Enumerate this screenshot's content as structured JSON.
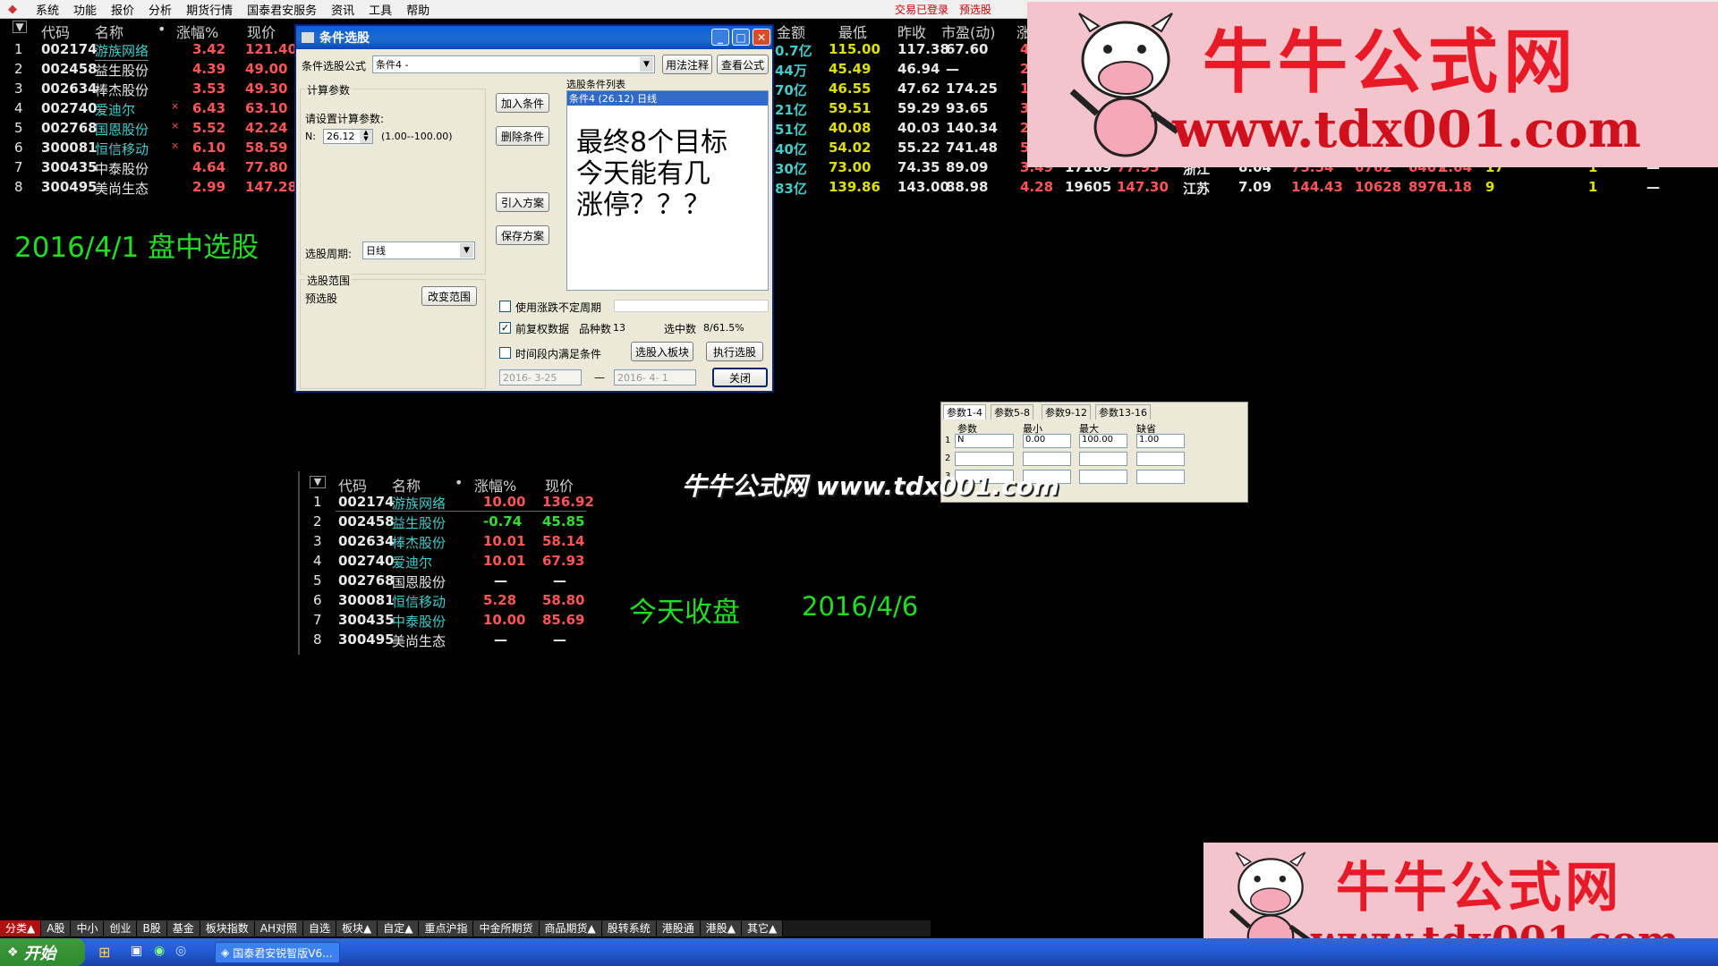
{
  "menu": {
    "items": [
      "系统",
      "功能",
      "报价",
      "分析",
      "期货行情",
      "国泰君安服务",
      "资讯",
      "工具",
      "帮助"
    ],
    "right1": "交易已登录",
    "right2": "预选股"
  },
  "top_table": {
    "headers": [
      "代码",
      "名称",
      "•",
      "涨幅%",
      "现价",
      "金额",
      "最低",
      "昨收",
      "市盈(动)",
      "涨"
    ],
    "rows": [
      {
        "n": "1",
        "code": "002174",
        "name": "游族网络",
        "mark": "",
        "chg": "3.42",
        "price": "121.40",
        "amt": "0.7亿",
        "low": "115.00",
        "prev": "117.38",
        "pe": "67.60",
        "rest": [
          "4"
        ]
      },
      {
        "n": "2",
        "code": "002458",
        "name": "益生股份",
        "mark": "",
        "chg": "4.39",
        "price": "49.00",
        "amt": "44万",
        "low": "45.49",
        "prev": "46.94",
        "pe": "—",
        "rest": [
          "2"
        ]
      },
      {
        "n": "3",
        "code": "002634",
        "name": "棒杰股份",
        "mark": "",
        "chg": "3.53",
        "price": "49.30",
        "amt": "70亿",
        "low": "46.55",
        "prev": "47.62",
        "pe": "174.25",
        "rest": [
          "1"
        ]
      },
      {
        "n": "4",
        "code": "002740",
        "name": "爱迪尔",
        "mark": "×",
        "chg": "6.43",
        "price": "63.10",
        "amt": "21亿",
        "low": "59.51",
        "prev": "59.29",
        "pe": "93.65",
        "rest": [
          "3"
        ]
      },
      {
        "n": "5",
        "code": "002768",
        "name": "国恩股份",
        "mark": "×",
        "chg": "5.52",
        "price": "42.24",
        "amt": "51亿",
        "low": "40.08",
        "prev": "40.03",
        "pe": "140.34",
        "rest": [
          "2"
        ]
      },
      {
        "n": "6",
        "code": "300081",
        "name": "恒信移动",
        "mark": "×",
        "chg": "6.10",
        "price": "58.59",
        "amt": "40亿",
        "low": "54.02",
        "prev": "55.22",
        "pe": "741.48",
        "rest": [
          "5"
        ]
      },
      {
        "n": "7",
        "code": "300435",
        "name": "中泰股份",
        "mark": "",
        "chg": "4.64",
        "price": "77.80",
        "amt": "30亿",
        "low": "73.00",
        "prev": "74.35",
        "pe": "89.09",
        "rest": [
          "3.49",
          "17169",
          "77.95",
          "浙江",
          "8.04",
          "75.54",
          "6762",
          "6407",
          "1.04",
          "17",
          "1",
          "—"
        ]
      },
      {
        "n": "8",
        "code": "300495",
        "name": "美尚生态",
        "mark": "",
        "chg": "2.99",
        "price": "147.28",
        "amt": "83亿",
        "low": "139.86",
        "prev": "143.00",
        "pe": "88.98",
        "rest": [
          "4.28",
          "19605",
          "147.30",
          "江苏",
          "7.09",
          "144.43",
          "10628",
          "8976",
          "1.18",
          "9",
          "1",
          "—"
        ]
      }
    ]
  },
  "label_date1": "2016/4/1  盘中选股",
  "dialog": {
    "title": "条件选股",
    "formula_label": "条件选股公式",
    "formula_value": "条件4          -",
    "btn_usage": "用法注释",
    "btn_view": "查看公式",
    "calc_params": "计算参数",
    "set_params": "请设置计算参数:",
    "n_label": "N:",
    "n_value": "26.12",
    "n_range": "(1.00--100.00)",
    "btn_add": "加入条件",
    "btn_del": "删除条件",
    "btn_import": "引入方案",
    "btn_save": "保存方案",
    "list_label": "选股条件列表",
    "list_item": "条件4 (26.12) 日线",
    "overlay_text": [
      "最终8个目标",
      "今天能有几",
      "涨停？？？"
    ],
    "period_label": "选股周期:",
    "period_value": "日线",
    "range_label": "选股范围",
    "range_value": "预选股",
    "btn_change": "改变范围",
    "cb_period": "使用涨跌不定周期",
    "cb_fq": "前复权数据",
    "varieties_label": "品种数",
    "varieties_value": "13",
    "selected_label": "选中数",
    "selected_value": "8/61.5%",
    "cb_time": "时间段内满足条件",
    "btn_to_block": "选股入板块",
    "btn_exec": "执行选股",
    "date_from": "2016- 3-25",
    "date_to": "2016- 4- 1",
    "date_sep": "—",
    "btn_close": "关闭"
  },
  "watermark": "牛牛公式网 www.tdx001.com",
  "param_panel": {
    "tabs": [
      "参数1-4",
      "参数5-8",
      "参数9-12",
      "参数13-16"
    ],
    "headers": [
      "参数",
      "最小",
      "最大",
      "缺省"
    ],
    "row_nums": [
      "1",
      "2",
      "3"
    ],
    "row1": [
      "N",
      "0.00",
      "100.00",
      "1.00"
    ]
  },
  "bottom_table": {
    "headers": [
      "代码",
      "名称",
      "•",
      "涨幅%",
      "现价"
    ],
    "rows": [
      {
        "n": "1",
        "code": "002174",
        "name": "游族网络",
        "chg": "10.00",
        "price": "136.92"
      },
      {
        "n": "2",
        "code": "002458",
        "name": "益生股份",
        "chg": "-0.74",
        "price": "45.85"
      },
      {
        "n": "3",
        "code": "002634",
        "name": "棒杰股份",
        "chg": "10.01",
        "price": "58.14"
      },
      {
        "n": "4",
        "code": "002740",
        "name": "爱迪尔",
        "chg": "10.01",
        "price": "67.93"
      },
      {
        "n": "5",
        "code": "002768",
        "name": "国恩股份",
        "chg": "—",
        "price": "—"
      },
      {
        "n": "6",
        "code": "300081",
        "name": "恒信移动",
        "chg": "5.28",
        "price": "58.80"
      },
      {
        "n": "7",
        "code": "300435",
        "name": "中泰股份",
        "chg": "10.00",
        "price": "85.69"
      },
      {
        "n": "8",
        "code": "300495",
        "name": "美尚生态",
        "chg": "—",
        "price": "—"
      }
    ]
  },
  "label_date2a": "今天收盘",
  "label_date2b": "2016/4/6",
  "ad": {
    "title": "牛牛公式网",
    "url": "www.tdx001.com"
  },
  "tabs": [
    "分类▲",
    "A股",
    "中小",
    "创业",
    "B股",
    "基金",
    "板块指数",
    "AH对照",
    "自选",
    "板块▲",
    "自定▲",
    "重点沪指",
    "中金所期货",
    "商品期货▲",
    "股转系统",
    "港股通",
    "港股▲",
    "其它▲"
  ],
  "taskbar": {
    "start": "开始",
    "app": "国泰君安锐智版V6..."
  }
}
